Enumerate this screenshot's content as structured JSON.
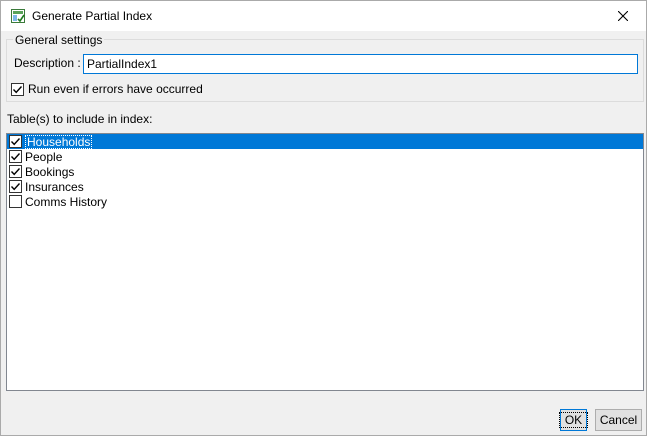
{
  "window": {
    "title": "Generate Partial Index",
    "icons": {
      "app": "index-app-icon",
      "close": "close-icon"
    }
  },
  "general": {
    "legend": "General settings",
    "description_label": "Description :",
    "description_value": "PartialIndex1",
    "run_label": "Run even if errors have occurred",
    "run_checked": true
  },
  "tables": {
    "label": "Table(s) to include in index:",
    "items": [
      {
        "label": "Households",
        "checked": true,
        "selected": true
      },
      {
        "label": "People",
        "checked": true,
        "selected": false
      },
      {
        "label": "Bookings",
        "checked": true,
        "selected": false
      },
      {
        "label": "Insurances",
        "checked": true,
        "selected": false
      },
      {
        "label": "Comms History",
        "checked": false,
        "selected": false
      }
    ]
  },
  "buttons": {
    "ok": "OK",
    "cancel": "Cancel"
  },
  "colors": {
    "accent": "#0078d7",
    "selection_text": "#ffffff"
  }
}
